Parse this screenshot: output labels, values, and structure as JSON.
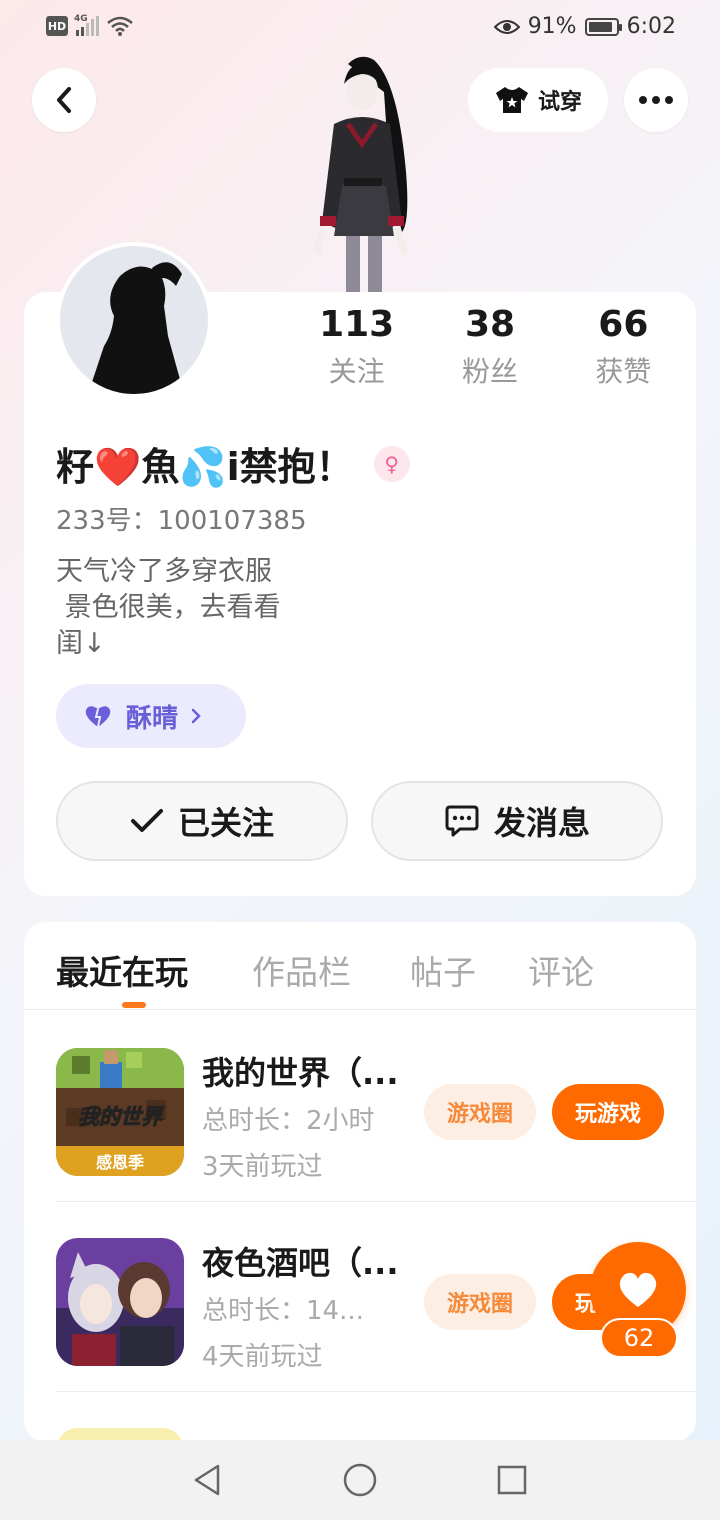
{
  "status_bar": {
    "hd": "HD",
    "network": "4G",
    "battery_pct": "91%",
    "battery_level": 0.91,
    "time": "6:02"
  },
  "header": {
    "tryon_label": "试穿"
  },
  "stats": [
    {
      "value": "113",
      "label": "关注"
    },
    {
      "value": "38",
      "label": "粉丝"
    },
    {
      "value": "66",
      "label": "获赞"
    }
  ],
  "profile": {
    "nickname": "籽❤️魚💦i禁抱！",
    "gender_symbol": "♀",
    "user_id": "233号：100107385",
    "bio": "天气冷了多穿衣服\n 景色很美，去看看\n闺↓",
    "tag_label": "酥晴",
    "follow_label": "已关注",
    "message_label": "发消息"
  },
  "tabs": [
    {
      "label": "最近在玩",
      "active": true
    },
    {
      "label": "作品栏",
      "active": false
    },
    {
      "label": "帖子",
      "active": false
    },
    {
      "label": "评论",
      "active": false
    }
  ],
  "games": [
    {
      "title": "我的世界（...",
      "duration": "总时长：2小时",
      "last_played": "3天前玩过",
      "circle_label": "游戏圈",
      "play_label": "玩游戏",
      "icon_text": "我的世界",
      "icon_sub": "感恩季"
    },
    {
      "title": "夜色酒吧（...",
      "duration": "总时长：14...",
      "last_played": "4天前玩过",
      "circle_label": "游戏圈",
      "play_label": "玩游戏"
    }
  ],
  "like": {
    "count": "62"
  },
  "colors": {
    "accent": "#ff6a00",
    "tag_bg": "#ebebfd",
    "tag_text": "#6a5fd8"
  }
}
